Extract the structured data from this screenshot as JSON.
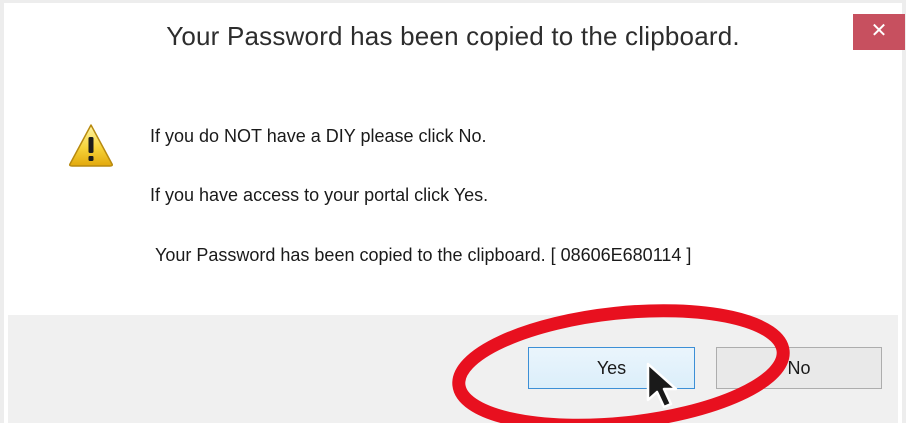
{
  "dialog": {
    "title": "Your Password has been copied to the clipboard.",
    "close_glyph": "✕",
    "icon": "warning-icon",
    "messages": [
      "If you do NOT have a DIY please click No.",
      "If you have access to your portal click Yes.",
      "Your Password has been copied to the clipboard. [ 08606E680114 ]"
    ],
    "buttons": {
      "yes_label": "Yes",
      "no_label": "No"
    }
  },
  "colors": {
    "close_button": "#c7505f",
    "highlight_ellipse": "#e8101f",
    "default_button_border": "#3c8fd6",
    "button_strip": "#f0f0f0"
  }
}
